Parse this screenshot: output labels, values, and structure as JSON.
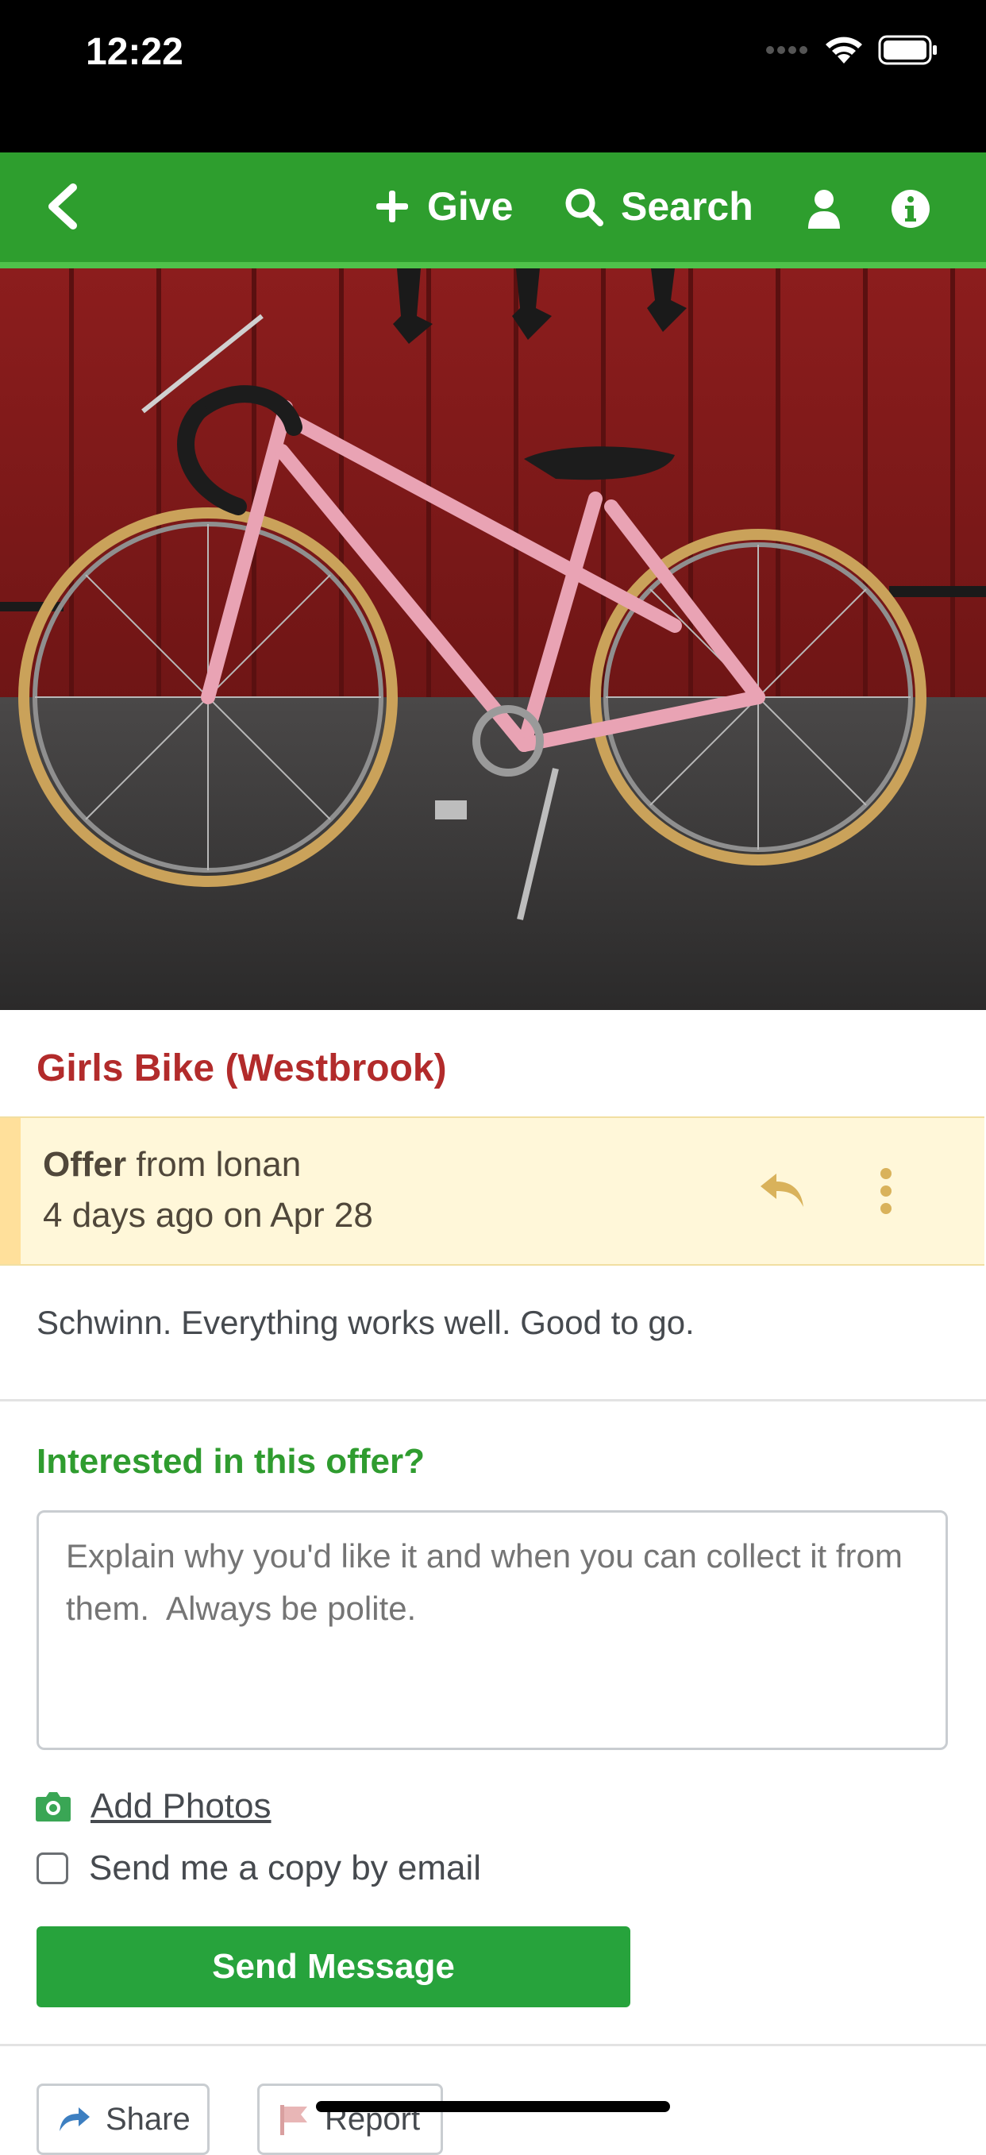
{
  "status_bar": {
    "time": "12:22"
  },
  "navbar": {
    "give_label": "Give",
    "search_label": "Search"
  },
  "post": {
    "title": "Girls Bike (Westbrook)",
    "type": "Offer",
    "from_text": "from lonan",
    "date_text": "4 days ago on Apr 28",
    "description": "Schwinn. Everything works well. Good to go."
  },
  "reply_form": {
    "heading": "Interested in this offer?",
    "placeholder": "Explain why you'd like it and when you can collect it from them.  Always be polite.",
    "add_photos_label": "Add Photos",
    "copy_label": "Send me a copy by email",
    "send_label": "Send Message"
  },
  "footer_buttons": {
    "share_label": "Share",
    "report_label": "Report"
  },
  "colors": {
    "brand_green": "#2e9e2e",
    "title_red": "#b22b2b",
    "offer_bg": "#fff7d9",
    "offer_accent": "#d9b25b"
  }
}
